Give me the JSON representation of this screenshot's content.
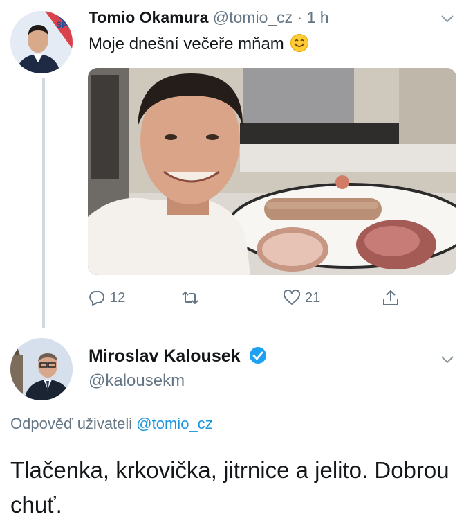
{
  "tweet1": {
    "author_name": "Tomio Okamura",
    "handle": "@tomio_cz",
    "separator": "·",
    "time": "1 h",
    "text": "Moje dnešní večeře mňam",
    "emoji": "smiling-face-emoji",
    "avatar_badge": "SPD",
    "stats": {
      "replies": "12",
      "likes": "21"
    }
  },
  "tweet2": {
    "author_name": "Miroslav Kalousek",
    "handle": "@kalousekm",
    "reply_prefix": "Odpověď uživateli",
    "reply_handle": "@tomio_cz",
    "text": "Tlačenka, krkovička, jitrnice a jelito. Dobrou chuť."
  },
  "colors": {
    "link": "#1b95e0",
    "muted": "#657786",
    "text": "#14171a",
    "verified": "#1da1f2",
    "thread_line": "#cfd9de"
  },
  "icons": [
    "reply-icon",
    "retweet-icon",
    "like-icon",
    "share-icon",
    "chevron-down-icon",
    "verified-badge-icon"
  ]
}
